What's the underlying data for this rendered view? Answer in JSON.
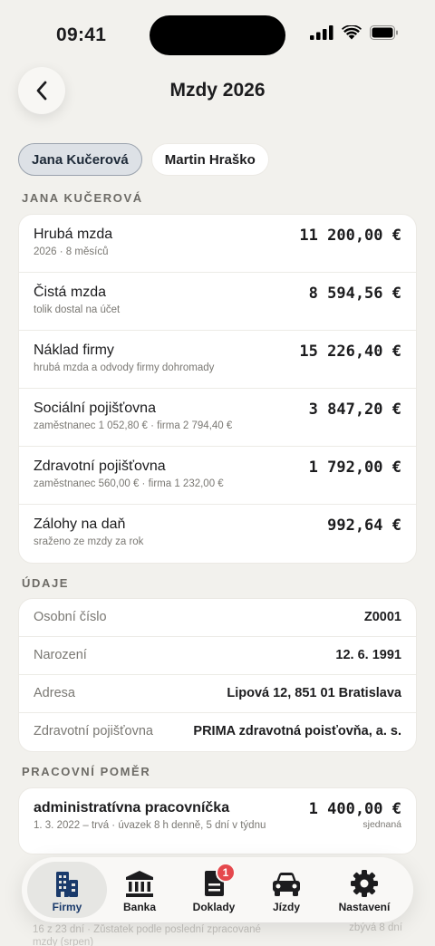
{
  "status_bar": {
    "time": "09:41"
  },
  "header": {
    "title": "Mzdy 2026"
  },
  "employees": [
    {
      "name": "Jana Kučerová",
      "selected": true
    },
    {
      "name": "Martin Hraško",
      "selected": false
    }
  ],
  "summary": {
    "section_label": "JANA KUČEROVÁ",
    "rows": [
      {
        "title": "Hrubá mzda",
        "sub": "2026 · 8 měsíců",
        "value": "11 200,00 €"
      },
      {
        "title": "Čistá mzda",
        "sub": "tolik dostal na účet",
        "value": "8 594,56 €"
      },
      {
        "title": "Náklad firmy",
        "sub": "hrubá mzda a odvody firmy dohromady",
        "value": "15 226,40 €"
      },
      {
        "title": "Sociální pojišťovna",
        "sub": "zaměstnanec 1 052,80 € · firma 2 794,40 €",
        "value": "3 847,20 €"
      },
      {
        "title": "Zdravotní pojišťovna",
        "sub": "zaměstnanec 560,00 € · firma 1 232,00 €",
        "value": "1 792,00 €"
      },
      {
        "title": "Zálohy na daň",
        "sub": "sraženo ze mzdy za rok",
        "value": "992,64 €"
      }
    ]
  },
  "details": {
    "section_label": "ÚDAJE",
    "rows": [
      {
        "label": "Osobní číslo",
        "value": "Z0001"
      },
      {
        "label": "Narození",
        "value": "12. 6. 1991"
      },
      {
        "label": "Adresa",
        "value": "Lipová 12, 851 01 Bratislava"
      },
      {
        "label": "Zdravotní pojišťovna",
        "value": "PRIMA zdravotná poisťovňa, a. s."
      }
    ]
  },
  "employment": {
    "section_label": "PRACOVNÍ POMĚR",
    "position": "administratívna pracovníčka",
    "terms": "1. 3. 2022 – trvá · úvazek 8 h denně, 5 dní v týdnu",
    "salary": "1 400,00 €",
    "salary_note": "sjednaná"
  },
  "ghost": {
    "line1": "16 z 23 dní · Zůstatek podle poslední zpracované",
    "line2": "mzdy (srpen)",
    "right": "zbývá 8 dní"
  },
  "tab_bar": {
    "tabs": [
      {
        "label": "Firmy",
        "icon": "building-icon",
        "active": true
      },
      {
        "label": "Banka",
        "icon": "bank-icon"
      },
      {
        "label": "Doklady",
        "icon": "document-icon",
        "badge": "1"
      },
      {
        "label": "Jízdy",
        "icon": "car-icon"
      },
      {
        "label": "Nastavení",
        "icon": "gear-icon"
      }
    ]
  },
  "colors": {
    "background": "#f2f1ed",
    "accent": "#1a3a6b",
    "badge": "#e5484d"
  }
}
